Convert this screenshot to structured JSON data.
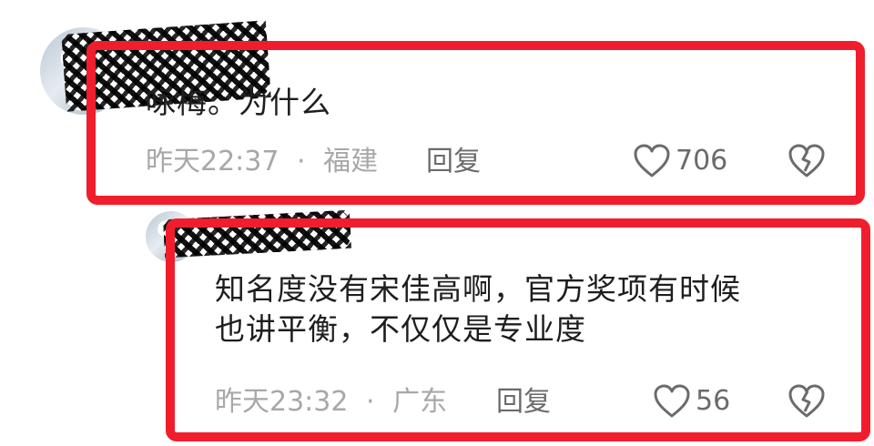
{
  "comments": [
    {
      "text": "咏梅。为什么",
      "time": "昨天22:37",
      "separator": "·",
      "location": "福建",
      "reply_label": "回复",
      "likes": "706",
      "like_icon": "heart-icon",
      "dislike_icon": "broken-heart-icon"
    },
    {
      "text": "知名度没有宋佳高啊，官方奖项有时候\n也讲平衡，不仅仅是专业度",
      "time": "昨天23:32",
      "separator": "·",
      "location": "广东",
      "reply_label": "回复",
      "likes": "56",
      "like_icon": "heart-icon",
      "dislike_icon": "broken-heart-icon"
    }
  ],
  "colors": {
    "highlight_border": "#f01e2c",
    "text": "#1e1e1e",
    "meta": "#a8a8a8",
    "action": "#6b6b6b"
  }
}
